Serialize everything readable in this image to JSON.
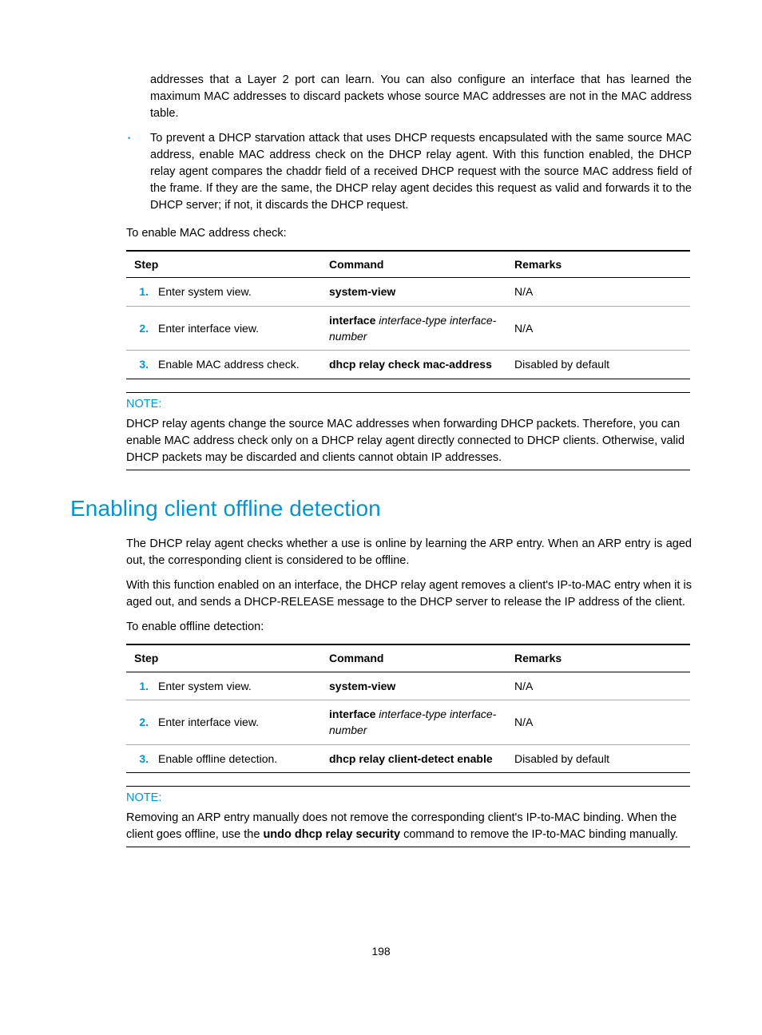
{
  "intro_para1": "addresses that a Layer 2 port can learn. You can also configure an interface that has learned the maximum MAC addresses to discard packets whose source MAC addresses are not in the MAC address table.",
  "bullet1": "To prevent a DHCP starvation attack that uses DHCP requests encapsulated with the same source MAC address, enable MAC address check on the DHCP relay agent. With this function enabled, the DHCP relay agent compares the chaddr field of a received DHCP request with the source MAC address field of the frame. If they are the same, the DHCP relay agent decides this request as valid and forwards it to the DHCP server; if not, it discards the DHCP request.",
  "enable_mac_intro": "To enable MAC address check:",
  "table_headers": {
    "step": "Step",
    "command": "Command",
    "remarks": "Remarks"
  },
  "table1": {
    "r1": {
      "num": "1.",
      "step": "Enter system view.",
      "cmd": "system-view",
      "remarks": "N/A"
    },
    "r2": {
      "num": "2.",
      "step": "Enter interface view.",
      "cmd_b": "interface",
      "cmd_i": " interface-type interface-number",
      "remarks": "N/A"
    },
    "r3": {
      "num": "3.",
      "step": "Enable MAC address check.",
      "cmd": "dhcp relay check mac-address",
      "remarks": "Disabled by default"
    }
  },
  "note_label": "NOTE:",
  "note1_body": "DHCP relay agents change the source MAC addresses when forwarding DHCP packets. Therefore, you can enable MAC address check only on a DHCP relay agent directly connected to DHCP clients. Otherwise, valid DHCP packets may be discarded and clients cannot obtain IP addresses.",
  "h1": "Enabling client offline detection",
  "body_p1": "The DHCP relay agent checks whether a use is online by learning the ARP entry. When an ARP entry is aged out, the corresponding client is considered to be offline.",
  "body_p2": "With this function enabled on an interface, the DHCP relay agent removes a client's IP-to-MAC entry when it is aged out, and sends a DHCP-RELEASE message to the DHCP server to release the IP address of the client.",
  "body_p3": "To enable offline detection:",
  "table2": {
    "r1": {
      "num": "1.",
      "step": "Enter system view.",
      "cmd": "system-view",
      "remarks": "N/A"
    },
    "r2": {
      "num": "2.",
      "step": "Enter interface view.",
      "cmd_b": "interface",
      "cmd_i": " interface-type interface-number",
      "remarks": "N/A"
    },
    "r3": {
      "num": "3.",
      "step": "Enable offline detection.",
      "cmd": "dhcp relay client-detect enable",
      "remarks": "Disabled by default"
    }
  },
  "note2_pre": "Removing an ARP entry manually does not remove the corresponding client's IP-to-MAC binding. When the client goes offline, use the ",
  "note2_bold": "undo dhcp relay security",
  "note2_post": " command to remove the IP-to-MAC binding manually.",
  "page_number": "198"
}
